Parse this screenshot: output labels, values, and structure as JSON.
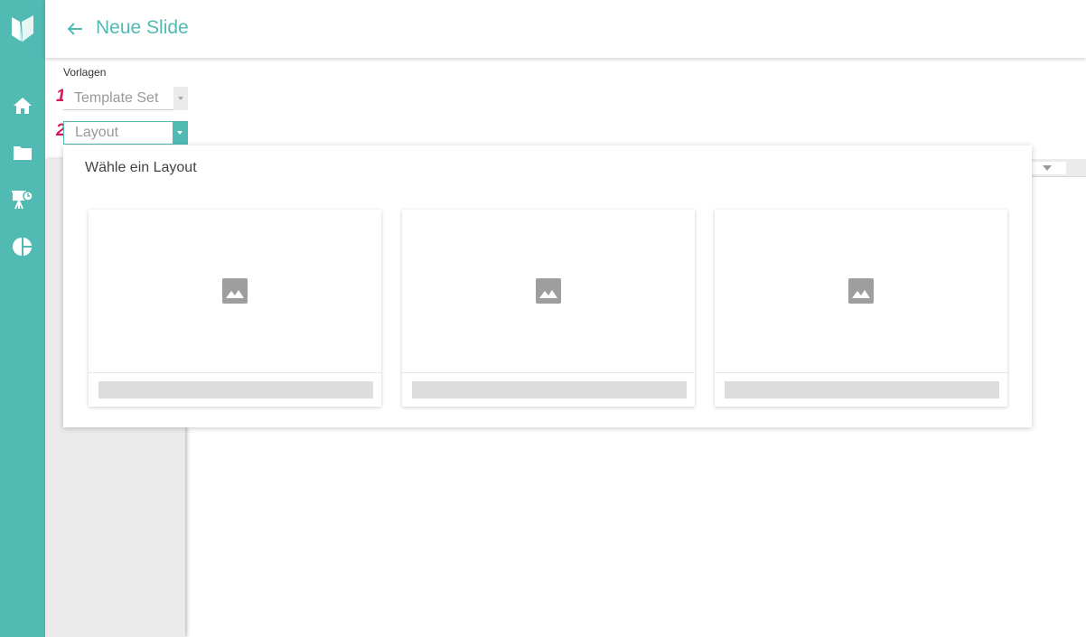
{
  "header": {
    "title": "Neue Slide"
  },
  "sidebar": {
    "items": [
      {
        "name": "home-icon"
      },
      {
        "name": "folder-icon"
      },
      {
        "name": "presentation-icon"
      },
      {
        "name": "pie-chart-icon"
      }
    ]
  },
  "form": {
    "section_label": "Vorlagen",
    "template_set": {
      "step": "1",
      "placeholder": "Template Set"
    },
    "layout": {
      "step": "2",
      "placeholder": "Layout"
    }
  },
  "layout_picker": {
    "title": "Wähle ein Layout",
    "cards": [
      {
        "icon": "image-icon"
      },
      {
        "icon": "image-icon"
      },
      {
        "icon": "image-icon"
      }
    ]
  },
  "colors": {
    "accent": "#50bab3",
    "step_number": "#d6185f"
  }
}
